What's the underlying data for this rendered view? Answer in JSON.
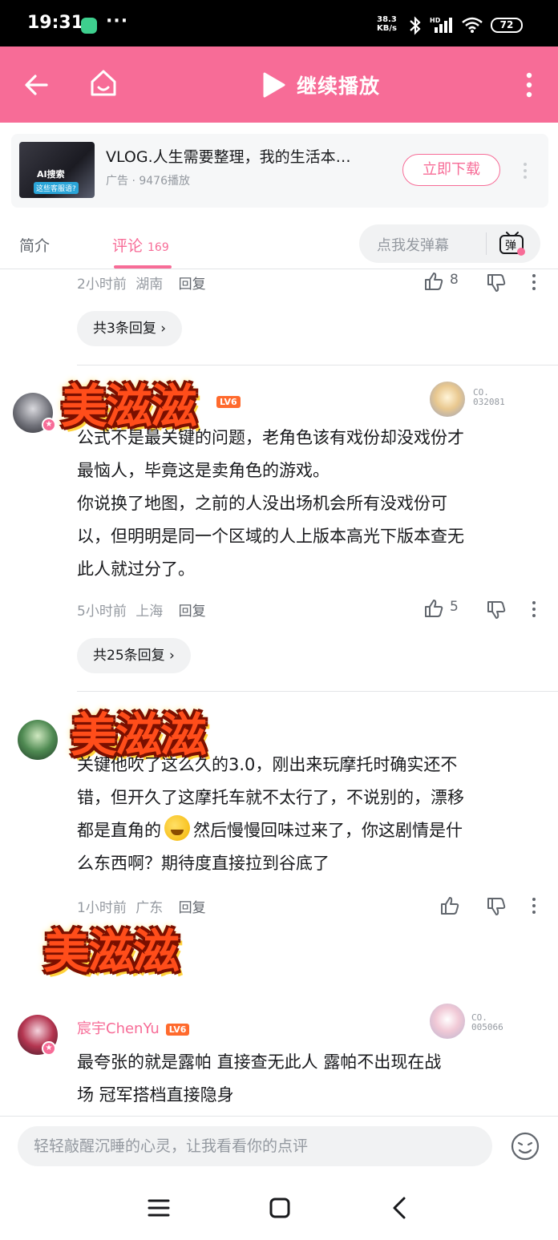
{
  "status_bar": {
    "time": "19:31",
    "dots": "···",
    "net_speed_value": "38.3",
    "net_speed_unit": "KB/s",
    "battery": "72",
    "hd": "HD"
  },
  "top_bar": {
    "continue_label": "继续播放",
    "color": "#f76c97"
  },
  "ad": {
    "thumb_tag": "AI搜索",
    "thumb_sub": "这些客服语?",
    "title": "VLOG.人生需要整理，我的生活本…",
    "meta": "广告 · 9476播放",
    "button_label": "立即下载"
  },
  "tabs": {
    "intro_label": "简介",
    "comments_label": "评论",
    "comments_count": "169",
    "danmaku_placeholder": "点我发弹幕",
    "danmaku_icon_char": "弹"
  },
  "comment0": {
    "meta_time": "2小时前",
    "meta_loc": "湖南",
    "reply": "回复",
    "likes": "8",
    "reply_pill": "共3条回复"
  },
  "comment1": {
    "level": "LV6",
    "fan_no_label": "CO.",
    "fan_no": "032081",
    "text_lines": [
      "公式不是最关键的问题，老角色该有戏份却没戏份才",
      "最恼人，毕竟这是卖角色的游戏。",
      "你说换了地图，之前的人没出场机会所有没戏份可",
      "以，但明明是同一个区域的人上版本高光下版本查无",
      "此人就过分了。"
    ],
    "meta_time": "5小时前",
    "meta_loc": "上海",
    "reply": "回复",
    "likes": "5",
    "reply_pill": "共25条回复"
  },
  "comment2": {
    "text_line1": "关键他吹了这么久的3.0，刚出来玩摩托时确实还不",
    "text_line2": "错，但开久了这摩托车就不太行了，不说别的，漂移",
    "text_line3_a": "都是直角的",
    "text_line3_b": "然后慢慢回味过来了，你这剧情是什",
    "text_line4": "么东西啊？期待度直接拉到谷底了",
    "meta_time": "1小时前",
    "meta_loc": "广东",
    "reply": "回复"
  },
  "comment3": {
    "username": "宸宇ChenYu",
    "level": "LV6",
    "fan_no_label": "CO.",
    "fan_no": "005066",
    "text_lines": [
      "最夸张的就是露帕  直接查无此人 露帕不出现在战",
      "场  冠军搭档直接隐身"
    ]
  },
  "sticker_text": "美滋滋",
  "bottom_input": {
    "placeholder": "轻轻敲醒沉睡的心灵，让我看看你的点评"
  }
}
